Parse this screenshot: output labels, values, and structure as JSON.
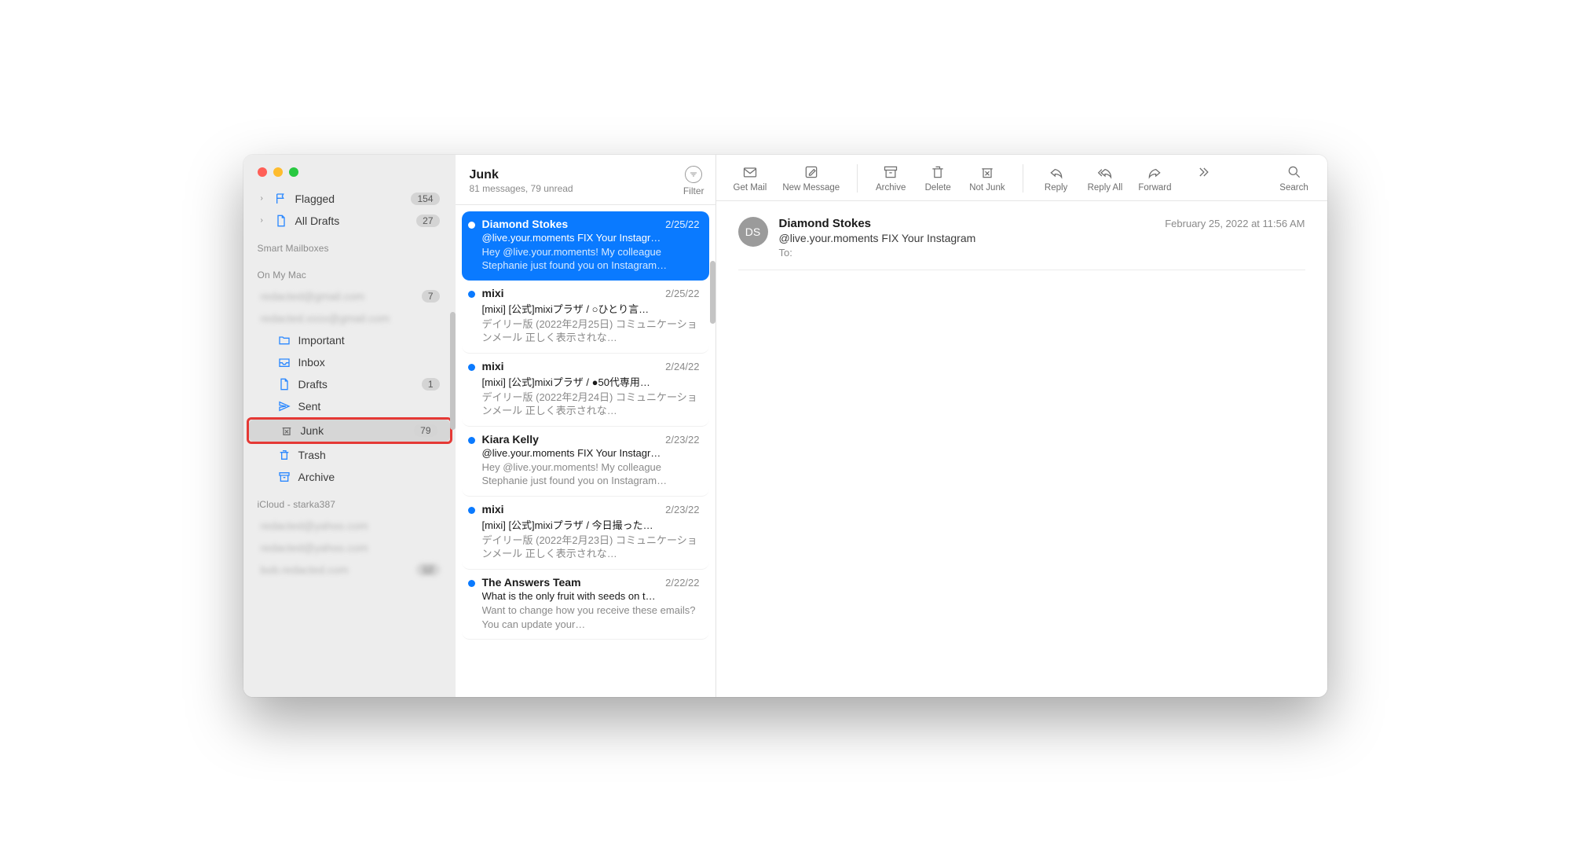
{
  "sidebar": {
    "flagged": {
      "label": "Flagged",
      "badge": "154"
    },
    "alldrafts": {
      "label": "All Drafts",
      "badge": "27"
    },
    "smart_hdr": "Smart Mailboxes",
    "onmymac_hdr": "On My Mac",
    "acct1": {
      "label": "redacted@gmail.com",
      "badge": "7"
    },
    "acct2": {
      "label": "redacted.xxxx@gmail.com"
    },
    "important": {
      "label": "Important"
    },
    "inbox": {
      "label": "Inbox"
    },
    "drafts": {
      "label": "Drafts",
      "badge": "1"
    },
    "sent": {
      "label": "Sent"
    },
    "junk": {
      "label": "Junk",
      "badge": "79"
    },
    "trash": {
      "label": "Trash"
    },
    "archive": {
      "label": "Archive"
    },
    "icloud_hdr": "iCloud - starka387",
    "acct3": {
      "label": "redacted@yahoo.com"
    },
    "acct4": {
      "label": "redacted@yahoo.com"
    },
    "acct5": {
      "label": "bob.redacted.com",
      "badge": "12"
    }
  },
  "listheader": {
    "title": "Junk",
    "subtitle": "81 messages, 79 unread",
    "filter": "Filter"
  },
  "messages": [
    {
      "sender": "Diamond Stokes",
      "date": "2/25/22",
      "subject": "@live.your.moments FIX Your Instagr…",
      "preview": "Hey @live.your.moments! My colleague Stephanie just found you on Instagram…",
      "unread": false,
      "selected": true
    },
    {
      "sender": "mixi",
      "date": "2/25/22",
      "subject": "[mixi] [公式]mixiプラザ / ○ひとり言…",
      "preview": "デイリー版 (2022年2月25日) コミュニケーションメール 正しく表示されな…",
      "unread": true
    },
    {
      "sender": "mixi",
      "date": "2/24/22",
      "subject": "[mixi] [公式]mixiプラザ / ●50代専用…",
      "preview": "デイリー版 (2022年2月24日) コミュニケーションメール 正しく表示されな…",
      "unread": true
    },
    {
      "sender": "Kiara Kelly",
      "date": "2/23/22",
      "subject": "@live.your.moments FIX Your Instagr…",
      "preview": "Hey @live.your.moments! My colleague Stephanie just found you on Instagram…",
      "unread": true
    },
    {
      "sender": "mixi",
      "date": "2/23/22",
      "subject": "[mixi] [公式]mixiプラザ / 今日撮った…",
      "preview": "デイリー版 (2022年2月23日) コミュニケーションメール 正しく表示されな…",
      "unread": true
    },
    {
      "sender": "The Answers Team",
      "date": "2/22/22",
      "subject": "What is the only fruit with seeds on t…",
      "preview": "Want to change how you receive these emails? You can update your…",
      "unread": true
    }
  ],
  "toolbar": {
    "getmail": "Get Mail",
    "newmsg": "New Message",
    "archive": "Archive",
    "delete": "Delete",
    "notjunk": "Not Junk",
    "reply": "Reply",
    "replyall": "Reply All",
    "forward": "Forward",
    "search": "Search"
  },
  "viewer": {
    "avatar": "DS",
    "from": "Diamond Stokes",
    "date": "February 25, 2022 at 11:56 AM",
    "subject": "@live.your.moments FIX Your Instagram",
    "to_label": "To:"
  }
}
